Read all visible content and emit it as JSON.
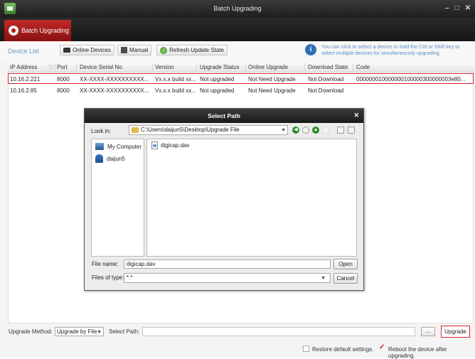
{
  "window": {
    "title": "Batch Upgrading",
    "controls": [
      "–",
      "□",
      "✕"
    ]
  },
  "tab": {
    "label": "Batch Upgrading"
  },
  "toolbar": {
    "device_list_label": "Device List",
    "online_devices_label": "Online Devices",
    "manual_label": "Manual",
    "refresh_label": "Refresh Update State",
    "hint_line1": "You can click to select a device or hold the Ctrl or Shift key to",
    "hint_line2": "select multiple devices for simultaneously upgrading."
  },
  "table": {
    "headers": [
      "IP Address",
      "Port",
      "Device Serial No.",
      "Version",
      "Upgrade Status",
      "Online Upgrade",
      "Download State",
      "Code"
    ],
    "rows": [
      {
        "ip": "10.16.2.221",
        "port": "8000",
        "serial": "XX-XXXX-XXXXXXXXXX...",
        "version": "Vx.x.x build xx...",
        "status": "Not upgraded",
        "online": "Not Need Upgrade",
        "download": "Not Download",
        "code": "000000010000000100000300000003e80..."
      },
      {
        "ip": "10.16.2.85",
        "port": "8000",
        "serial": "XX-XXXX-XXXXXXXXXX...",
        "version": "Vx.x.x build xx...",
        "status": "Not upgraded",
        "online": "Not Need Upgrade",
        "download": "Not Download",
        "code": ""
      }
    ]
  },
  "dialog": {
    "title": "Select Path",
    "look_in_label": "Look in:",
    "path": "C:\\Users\\daijun5\\Desktop\\Upgrade File",
    "sidebar": [
      "My Computer",
      "daijun5"
    ],
    "files": [
      "digicap.dav"
    ],
    "file_name_label": "File name:",
    "file_name_value": "digicap.dav",
    "files_of_type_label": "Files of type:",
    "files_of_type_value": "*.*",
    "open_label": "Open",
    "cancel_label": "Cancel"
  },
  "bottom": {
    "upgrade_method_label": "Upgrade Method:",
    "upgrade_method_value": "Upgrade by File",
    "select_path_label": "Select Path:",
    "browse_label": "...",
    "upgrade_label": "Upgrade",
    "restore_label": "Restore default settings.",
    "reboot_label": "Reboot the device after upgrading."
  },
  "colors": {
    "accent_red": "#d7262e",
    "link_blue": "#6a9ac4",
    "title_dark": "#1e1e1e"
  }
}
